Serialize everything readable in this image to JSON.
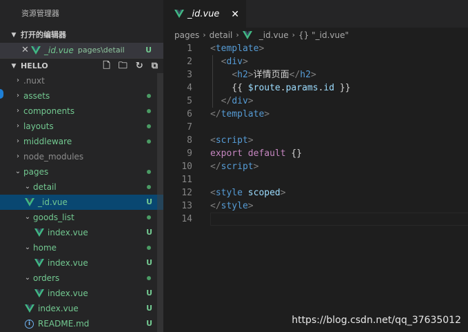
{
  "explorer": {
    "title": "资源管理器",
    "open_editors": {
      "heading": "打开的编辑器",
      "items": [
        {
          "close_glyph": "✕",
          "icon": "vue-icon",
          "name": "_id.vue",
          "path": "pages\\detail",
          "status": "U"
        }
      ]
    },
    "project": {
      "heading": "HELLO",
      "toolbar": [
        "new-file-icon",
        "new-folder-icon",
        "refresh-icon",
        "collapse-all-icon"
      ]
    },
    "tree": [
      {
        "label": ".nuxt",
        "chev": "›",
        "style": "dim"
      },
      {
        "label": "assets",
        "chev": "›",
        "style": "green",
        "badge": "dot"
      },
      {
        "label": "components",
        "chev": "›",
        "style": "green",
        "badge": "dot"
      },
      {
        "label": "layouts",
        "chev": "›",
        "style": "green",
        "badge": "dot"
      },
      {
        "label": "middleware",
        "chev": "›",
        "style": "green",
        "badge": "dot"
      },
      {
        "label": "node_modules",
        "chev": "›",
        "style": "dim"
      },
      {
        "label": "pages",
        "chev": "⌄",
        "style": "green",
        "badge": "dot"
      },
      {
        "label": "detail",
        "chev": "⌄",
        "style": "green",
        "badge": "dot"
      },
      {
        "label": "_id.vue",
        "style": "green",
        "badge": "U",
        "icon": "vue-icon",
        "selected": true
      },
      {
        "label": "goods_list",
        "chev": "⌄",
        "style": "green",
        "badge": "dot"
      },
      {
        "label": "index.vue",
        "style": "green",
        "badge": "U",
        "icon": "vue-icon"
      },
      {
        "label": "home",
        "chev": "⌄",
        "style": "green",
        "badge": "dot"
      },
      {
        "label": "index.vue",
        "style": "green",
        "badge": "U",
        "icon": "vue-icon"
      },
      {
        "label": "orders",
        "chev": "⌄",
        "style": "green",
        "badge": "dot"
      },
      {
        "label": "index.vue",
        "style": "green",
        "badge": "U",
        "icon": "vue-icon"
      },
      {
        "label": "index.vue",
        "style": "green",
        "badge": "U",
        "icon": "vue-icon"
      },
      {
        "label": "README.md",
        "style": "green",
        "badge": "U",
        "icon": "info-icon"
      }
    ]
  },
  "editor": {
    "tab": {
      "name": "_id.vue",
      "close_glyph": "✕"
    },
    "breadcrumb": [
      "pages",
      "detail",
      "_id.vue",
      "{} \"_id.vue\""
    ],
    "lines": [
      {
        "n": "1",
        "tokens": [
          [
            "t-punct",
            "<"
          ],
          [
            "t-tag",
            "template"
          ],
          [
            "t-punct",
            ">"
          ]
        ]
      },
      {
        "n": "2",
        "tokens": [
          [
            "t-text",
            "  "
          ],
          [
            "t-punct",
            "<"
          ],
          [
            "t-tag",
            "div"
          ],
          [
            "t-punct",
            ">"
          ]
        ]
      },
      {
        "n": "3",
        "tokens": [
          [
            "t-text",
            "    "
          ],
          [
            "t-punct",
            "<"
          ],
          [
            "t-tag",
            "h2"
          ],
          [
            "t-punct",
            ">"
          ],
          [
            "t-text",
            "详情页面"
          ],
          [
            "t-punct",
            "</"
          ],
          [
            "t-tag",
            "h2"
          ],
          [
            "t-punct",
            ">"
          ]
        ]
      },
      {
        "n": "4",
        "tokens": [
          [
            "t-text",
            "    {{ "
          ],
          [
            "t-var",
            "$route"
          ],
          [
            "t-text",
            "."
          ],
          [
            "t-var",
            "params"
          ],
          [
            "t-text",
            "."
          ],
          [
            "t-var",
            "id"
          ],
          [
            "t-text",
            " }}"
          ]
        ]
      },
      {
        "n": "5",
        "tokens": [
          [
            "t-text",
            "  "
          ],
          [
            "t-punct",
            "</"
          ],
          [
            "t-tag",
            "div"
          ],
          [
            "t-punct",
            ">"
          ]
        ]
      },
      {
        "n": "6",
        "tokens": [
          [
            "t-punct",
            "</"
          ],
          [
            "t-tag",
            "template"
          ],
          [
            "t-punct",
            ">"
          ]
        ]
      },
      {
        "n": "7",
        "tokens": []
      },
      {
        "n": "8",
        "tokens": [
          [
            "t-punct",
            "<"
          ],
          [
            "t-tag",
            "script"
          ],
          [
            "t-punct",
            ">"
          ]
        ]
      },
      {
        "n": "9",
        "tokens": [
          [
            "t-kw",
            "export"
          ],
          [
            "t-text",
            " "
          ],
          [
            "t-kw",
            "default"
          ],
          [
            "t-text",
            " {}"
          ]
        ]
      },
      {
        "n": "10",
        "tokens": [
          [
            "t-punct",
            "</"
          ],
          [
            "t-tag",
            "script"
          ],
          [
            "t-punct",
            ">"
          ]
        ]
      },
      {
        "n": "11",
        "tokens": []
      },
      {
        "n": "12",
        "tokens": [
          [
            "t-punct",
            "<"
          ],
          [
            "t-tag",
            "style"
          ],
          [
            "t-text",
            " "
          ],
          [
            "t-attr",
            "scoped"
          ],
          [
            "t-punct",
            ">"
          ]
        ]
      },
      {
        "n": "13",
        "tokens": [
          [
            "t-punct",
            "</"
          ],
          [
            "t-tag",
            "style"
          ],
          [
            "t-punct",
            ">"
          ]
        ]
      },
      {
        "n": "14",
        "tokens": [],
        "current": true
      }
    ]
  },
  "watermark": "https://blog.csdn.net/qq_37635012",
  "colors": {
    "accent_green": "#73c991",
    "selection": "#094771",
    "tag": "#569cd6"
  }
}
